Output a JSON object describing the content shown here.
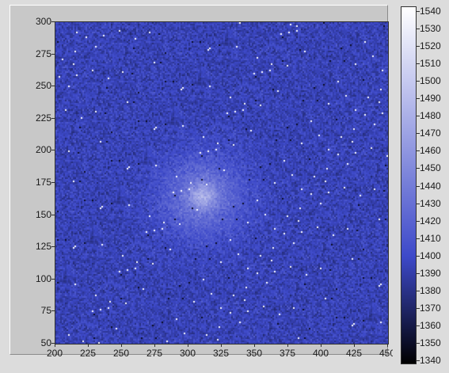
{
  "plot": {
    "x_ticks": [
      "200",
      "225",
      "250",
      "275",
      "300",
      "325",
      "350",
      "375",
      "400",
      "425",
      "450"
    ],
    "y_ticks": [
      "300",
      "275",
      "250",
      "225",
      "200",
      "175",
      "150",
      "125",
      "100",
      "75",
      "50"
    ]
  },
  "color_scale": {
    "ticks": [
      "1540",
      "1530",
      "1520",
      "1510",
      "1500",
      "1490",
      "1480",
      "1470",
      "1460",
      "1450",
      "1440",
      "1430",
      "1420",
      "1410",
      "1400",
      "1390",
      "1380",
      "1370",
      "1360",
      "1350",
      "1340"
    ],
    "colors": {
      "low": "#000000",
      "mid": "#3d49c9",
      "high": "#ffffff"
    }
  },
  "chart_data": {
    "type": "heatmap",
    "xlim": [
      200,
      450
    ],
    "ylim": [
      50,
      300
    ],
    "zlim": [
      1340,
      1540
    ],
    "background_level": 1395,
    "feature": {
      "type": "diffuse-blob",
      "center": [
        310,
        165
      ],
      "peak_value": 1470
    }
  }
}
